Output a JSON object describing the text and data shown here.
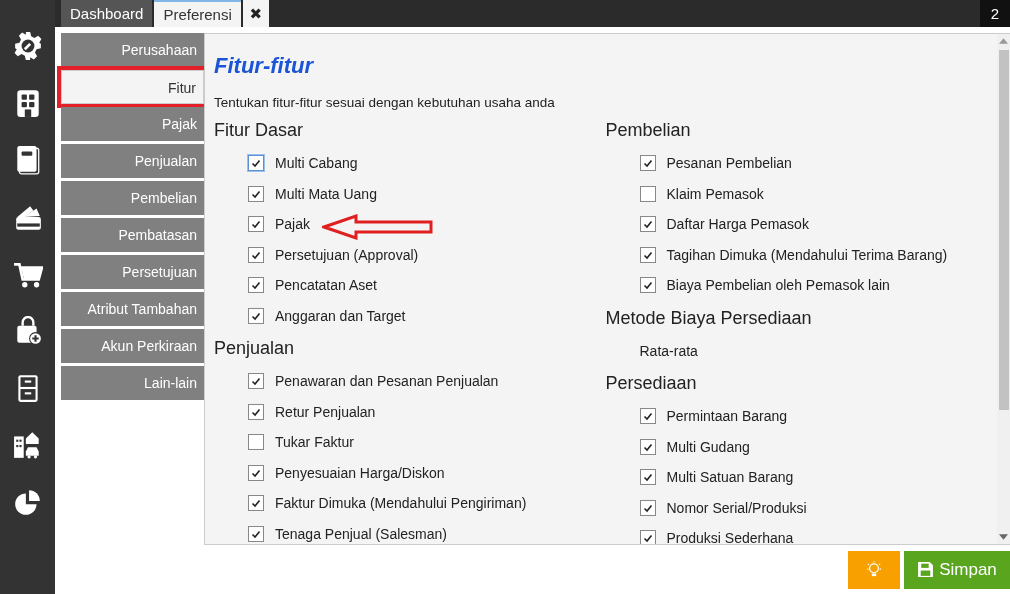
{
  "tabs": [
    {
      "label": "Dashboard",
      "selected": false
    },
    {
      "label": "Preferensi",
      "selected": true
    }
  ],
  "tab_close": "✖",
  "window_count": "2",
  "menu": [
    {
      "label": "Perusahaan",
      "selected": false
    },
    {
      "label": "Fitur",
      "selected": true
    },
    {
      "label": "Pajak",
      "selected": false
    },
    {
      "label": "Penjualan",
      "selected": false
    },
    {
      "label": "Pembelian",
      "selected": false
    },
    {
      "label": "Pembatasan",
      "selected": false
    },
    {
      "label": "Persetujuan",
      "selected": false
    },
    {
      "label": "Atribut Tambahan",
      "selected": false
    },
    {
      "label": "Akun Perkiraan",
      "selected": false
    },
    {
      "label": "Lain-lain",
      "selected": false
    }
  ],
  "title": "Fitur-fitur",
  "description": "Tentukan fitur-fitur sesuai dengan kebutuhan usaha anda",
  "columns": [
    {
      "sections": [
        {
          "title": "Fitur Dasar",
          "items": [
            {
              "kind": "checkbox",
              "label": "Multi Cabang",
              "checked": true
            },
            {
              "kind": "checkbox",
              "label": "Multi Mata Uang",
              "checked": true
            },
            {
              "kind": "checkbox",
              "label": "Pajak",
              "checked": true
            },
            {
              "kind": "checkbox",
              "label": "Persetujuan (Approval)",
              "checked": true
            },
            {
              "kind": "checkbox",
              "label": "Pencatatan Aset",
              "checked": true
            },
            {
              "kind": "checkbox",
              "label": "Anggaran dan Target",
              "checked": true
            }
          ]
        },
        {
          "title": "Penjualan",
          "items": [
            {
              "kind": "checkbox",
              "label": "Penawaran dan Pesanan Penjualan",
              "checked": true
            },
            {
              "kind": "checkbox",
              "label": "Retur Penjualan",
              "checked": true
            },
            {
              "kind": "checkbox",
              "label": "Tukar Faktur",
              "checked": false
            },
            {
              "kind": "checkbox",
              "label": "Penyesuaian Harga/Diskon",
              "checked": true
            },
            {
              "kind": "checkbox",
              "label": "Faktur Dimuka (Mendahului Pengiriman)",
              "checked": true
            },
            {
              "kind": "checkbox",
              "label": "Tenaga Penjual (Salesman)",
              "checked": true
            }
          ]
        }
      ]
    },
    {
      "sections": [
        {
          "title": "Pembelian",
          "items": [
            {
              "kind": "checkbox",
              "label": "Pesanan Pembelian",
              "checked": true
            },
            {
              "kind": "checkbox",
              "label": "Klaim Pemasok",
              "checked": false
            },
            {
              "kind": "checkbox",
              "label": "Daftar Harga Pemasok",
              "checked": true
            },
            {
              "kind": "checkbox",
              "label": "Tagihan Dimuka (Mendahului Terima Barang)",
              "checked": true
            },
            {
              "kind": "checkbox",
              "label": "Biaya Pembelian oleh Pemasok lain",
              "checked": true
            }
          ]
        },
        {
          "title": "Metode Biaya Persediaan",
          "items": [
            {
              "kind": "text",
              "label": "Rata-rata"
            }
          ]
        },
        {
          "title": "Persediaan",
          "items": [
            {
              "kind": "checkbox",
              "label": "Permintaan Barang",
              "checked": true
            },
            {
              "kind": "checkbox",
              "label": "Multi Gudang",
              "checked": true
            },
            {
              "kind": "checkbox",
              "label": "Multi Satuan Barang",
              "checked": true
            },
            {
              "kind": "checkbox",
              "label": "Nomor Serial/Produksi",
              "checked": true
            },
            {
              "kind": "checkbox",
              "label": "Produksi Sederhana",
              "checked": true
            }
          ]
        }
      ]
    }
  ],
  "save_button": "Simpan"
}
